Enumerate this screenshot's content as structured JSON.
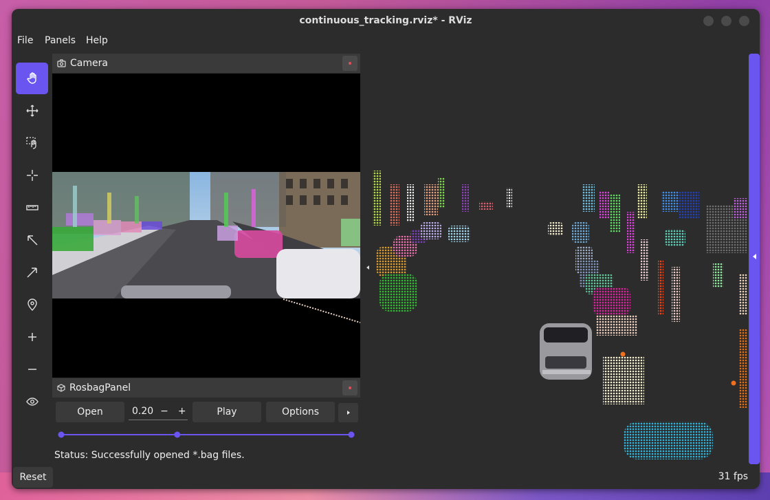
{
  "window": {
    "title": "continuous_tracking.rviz* - RViz"
  },
  "menu": {
    "file": "File",
    "panels": "Panels",
    "help": "Help"
  },
  "toolbar": {
    "tools": [
      "hand-interact-icon",
      "move-camera-icon",
      "select-icon",
      "focus-camera-icon",
      "measure-icon",
      "pose-estimate-icon",
      "nav-goal-icon",
      "publish-point-icon",
      "zoom-in-icon",
      "zoom-out-icon",
      "visibility-eye-icon"
    ]
  },
  "camera_panel": {
    "title": "Camera"
  },
  "rosbag_panel": {
    "title": "RosbagPanel",
    "open_label": "Open",
    "rate_value": "0.20",
    "minus": "−",
    "plus": "+",
    "play_label": "Play",
    "options_label": "Options",
    "timeline": [
      0.0,
      0.4,
      1.0
    ]
  },
  "status": "Status: Successfully opened *.bag files.",
  "reset_label": "Reset",
  "fps": "31 fps",
  "colors": {
    "accent": "#6b55f0",
    "window": "#2c2c2c",
    "panel_header": "#3a3a3a",
    "close_dot": "#e0505a"
  }
}
